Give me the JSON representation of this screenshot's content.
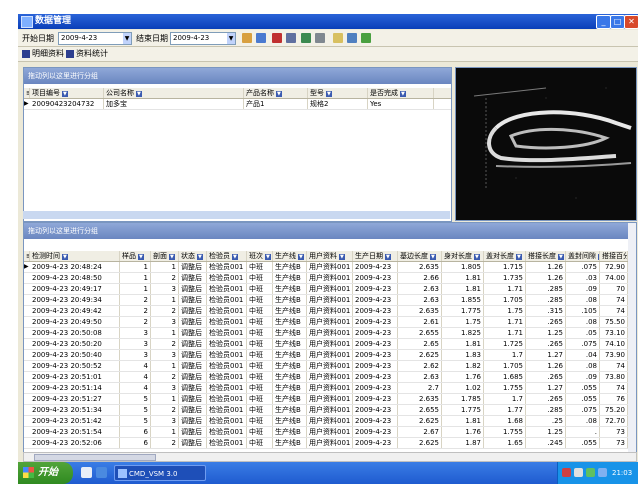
{
  "window": {
    "title": "数据管理",
    "minimize_glyph": "_",
    "maximize_glyph": "□",
    "close_glyph": "✕"
  },
  "toolbar": {
    "start_date_label": "开始日期",
    "start_date_value": "2009-4-23",
    "end_date_label": "结束日期",
    "end_date_value": "2009-4-23",
    "icons": [
      "home-icon",
      "home-alt-icon",
      "close-doc-icon",
      "edit-icon",
      "grid-icon",
      "print-icon",
      "open-file-icon",
      "export-icon",
      "refresh-icon"
    ]
  },
  "tabs": {
    "detail_label": "明细资料",
    "stats_label": "资料统计"
  },
  "top_panel": {
    "group_hint": "拖动列以这里进行分组",
    "columns": [
      "项目编号",
      "公司名称",
      "产品名称",
      "型号",
      "是否完成"
    ],
    "rows": [
      [
        "20090423204732",
        "加多宝",
        "产品1",
        "规格2",
        "Yes"
      ]
    ]
  },
  "bottom_panel": {
    "group_hint": "拖动列以这里进行分组",
    "columns": [
      "检测时间",
      "样品",
      "剖面",
      "状态",
      "检验员",
      "班次",
      "生产线",
      "用户资料",
      "生产日期",
      "基边长度",
      "身对长度",
      "盖对长度",
      "搭接长度",
      "盖封间隙",
      "搭接百分率"
    ],
    "rows": [
      [
        "2009-4-23 20:48:24",
        "1",
        "1",
        "调整后",
        "检验员001",
        "中班",
        "生产线B",
        "用户资料001",
        "2009-4-23",
        "2.635",
        "1.805",
        "1.715",
        "1.26",
        ".075",
        "72.90"
      ],
      [
        "2009-4-23 20:48:50",
        "1",
        "2",
        "调整后",
        "检验员001",
        "中班",
        "生产线B",
        "用户资料001",
        "2009-4-23",
        "2.66",
        "1.81",
        "1.735",
        "1.26",
        ".03",
        "74.00"
      ],
      [
        "2009-4-23 20:49:17",
        "1",
        "3",
        "调整后",
        "检验员001",
        "中班",
        "生产线B",
        "用户资料001",
        "2009-4-23",
        "2.63",
        "1.81",
        "1.71",
        ".285",
        ".09",
        "70"
      ],
      [
        "2009-4-23 20:49:34",
        "2",
        "1",
        "调整后",
        "检验员001",
        "中班",
        "生产线B",
        "用户资料001",
        "2009-4-23",
        "2.63",
        "1.855",
        "1.705",
        ".285",
        ".08",
        "74"
      ],
      [
        "2009-4-23 20:49:42",
        "2",
        "2",
        "调整后",
        "检验员001",
        "中班",
        "生产线B",
        "用户资料001",
        "2009-4-23",
        "2.635",
        "1.775",
        "1.75",
        ".315",
        ".105",
        "74"
      ],
      [
        "2009-4-23 20:49:50",
        "2",
        "3",
        "调整后",
        "检验员001",
        "中班",
        "生产线B",
        "用户资料001",
        "2009-4-23",
        "2.61",
        "1.75",
        "1.71",
        ".265",
        ".08",
        "75.50"
      ],
      [
        "2009-4-23 20:50:08",
        "3",
        "1",
        "调整后",
        "检验员001",
        "中班",
        "生产线B",
        "用户资料001",
        "2009-4-23",
        "2.655",
        "1.825",
        "1.71",
        "1.25",
        ".05",
        "73.10"
      ],
      [
        "2009-4-23 20:50:20",
        "3",
        "2",
        "调整后",
        "检验员001",
        "中班",
        "生产线B",
        "用户资料001",
        "2009-4-23",
        "2.65",
        "1.81",
        "1.725",
        ".265",
        ".075",
        "74.10"
      ],
      [
        "2009-4-23 20:50:40",
        "3",
        "3",
        "调整后",
        "检验员001",
        "中班",
        "生产线B",
        "用户资料001",
        "2009-4-23",
        "2.625",
        "1.83",
        "1.7",
        "1.27",
        ".04",
        "73.90"
      ],
      [
        "2009-4-23 20:50:52",
        "4",
        "1",
        "调整后",
        "检验员001",
        "中班",
        "生产线B",
        "用户资料001",
        "2009-4-23",
        "2.62",
        "1.82",
        "1.705",
        "1.26",
        ".08",
        "74"
      ],
      [
        "2009-4-23 20:51:01",
        "4",
        "2",
        "调整后",
        "检验员001",
        "中班",
        "生产线B",
        "用户资料001",
        "2009-4-23",
        "2.63",
        "1.76",
        "1.685",
        ".265",
        ".09",
        "73.80"
      ],
      [
        "2009-4-23 20:51:14",
        "4",
        "3",
        "调整后",
        "检验员001",
        "中班",
        "生产线B",
        "用户资料001",
        "2009-4-23",
        "2.7",
        "1.02",
        "1.755",
        "1.27",
        ".055",
        "74"
      ],
      [
        "2009-4-23 20:51:27",
        "5",
        "1",
        "调整后",
        "检验员001",
        "中班",
        "生产线B",
        "用户资料001",
        "2009-4-23",
        "2.635",
        "1.785",
        "1.7",
        ".265",
        ".055",
        "76"
      ],
      [
        "2009-4-23 20:51:34",
        "5",
        "2",
        "调整后",
        "检验员001",
        "中班",
        "生产线B",
        "用户资料001",
        "2009-4-23",
        "2.655",
        "1.775",
        "1.77",
        ".285",
        ".075",
        "75.20"
      ],
      [
        "2009-4-23 20:51:42",
        "5",
        "3",
        "调整后",
        "检验员001",
        "中班",
        "生产线B",
        "用户资料001",
        "2009-4-23",
        "2.625",
        "1.81",
        "1.68",
        ".25",
        ".08",
        "72.70"
      ],
      [
        "2009-4-23 20:51:54",
        "6",
        "1",
        "调整后",
        "检验员001",
        "中班",
        "生产线B",
        "用户资料001",
        "2009-4-23",
        "2.67",
        "1.76",
        "1.755",
        "1.25",
        ".",
        "73"
      ],
      [
        "2009-4-23 20:52:06",
        "6",
        "2",
        "调整后",
        "检验员001",
        "中班",
        "生产线B",
        "用户资料001",
        "2009-4-23",
        "2.625",
        "1.87",
        "1.65",
        ".245",
        ".055",
        "73"
      ]
    ]
  },
  "taskbar": {
    "start_label": "开始",
    "task_label": "CMD_VSM 3.0",
    "clock": "21:03"
  }
}
